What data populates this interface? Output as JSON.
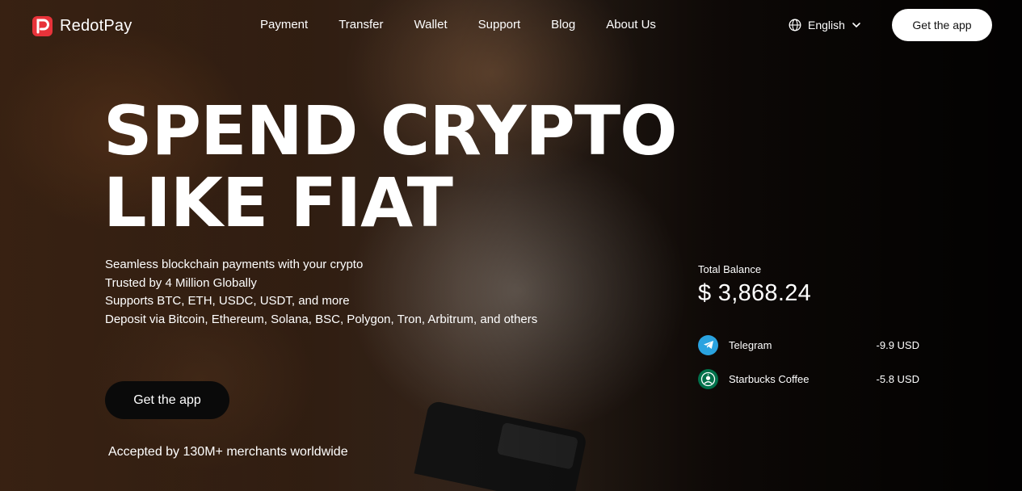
{
  "brand": {
    "name": "RedotPay",
    "color": "#e8333a"
  },
  "nav": {
    "links": [
      "Payment",
      "Transfer",
      "Wallet",
      "Support",
      "Blog",
      "About Us"
    ],
    "language": "English",
    "cta": "Get the app"
  },
  "hero": {
    "headline": [
      "SPEND CRYPTO",
      "LIKE FIAT"
    ],
    "bullets": [
      "Seamless blockchain payments with your crypto",
      "Trusted by 4 Million Globally",
      "Supports BTC, ETH, USDC, USDT, and more",
      "Deposit via Bitcoin, Ethereum, Solana, BSC, Polygon, Tron, Arbitrum, and others"
    ],
    "cta": "Get the app",
    "accepted": "Accepted by 130M+ merchants worldwide"
  },
  "balance": {
    "label": "Total Balance",
    "value": "$ 3,868.24",
    "transactions": [
      {
        "name": "Telegram",
        "amount": "-9.9 USD",
        "icon": "telegram-icon",
        "color": "#2aa3e0"
      },
      {
        "name": "Starbucks Coffee",
        "amount": "-5.8 USD",
        "icon": "starbucks-icon",
        "color": "#00704a"
      }
    ]
  }
}
